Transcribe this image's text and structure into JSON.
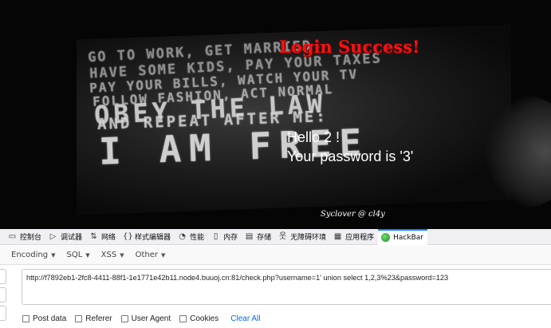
{
  "page": {
    "poster_lines": [
      "GO TO WORK, GET MARRIED",
      "HAVE SOME KIDS, PAY YOUR TAXES",
      "PAY YOUR BILLS, WATCH YOUR TV",
      "FOLLOW FASHION, ACT NORMAL",
      "OBEY THE LAW",
      "AND REPEAT AFTER ME:",
      "I AM FREE"
    ],
    "login_message": "Login Success!",
    "hello": "Hello 2 !",
    "password_message": "Your password is '3'",
    "signature": "Syclover @ cl4y",
    "accent_color": "#ff1010"
  },
  "devtools": {
    "tabs": [
      {
        "icon": "inspector-icon",
        "label": "控制台"
      },
      {
        "icon": "console-icon",
        "label": "调试器"
      },
      {
        "icon": "network-icon",
        "label": "网络"
      },
      {
        "icon": "style-editor-icon",
        "label": "样式编辑器"
      },
      {
        "icon": "performance-icon",
        "label": "性能"
      },
      {
        "icon": "memory-icon",
        "label": "内存"
      },
      {
        "icon": "storage-icon",
        "label": "存储"
      },
      {
        "icon": "accessibility-icon",
        "label": "无障碍环境"
      },
      {
        "icon": "application-icon",
        "label": "应用程序"
      },
      {
        "icon": "hackbar-icon",
        "label": "HackBar"
      }
    ],
    "active_tab": "HackBar",
    "active_color": "#0a84ff"
  },
  "hackbar": {
    "menus": [
      "Encoding",
      "SQL",
      "XSS",
      "Other"
    ],
    "url": "http://f7892eb1-2fc8-4411-88f1-1e1771e42b11.node4.buuoj.cn:81/check.php?username=1' union select 1,2,3%23&password=123",
    "options": [
      "Post data",
      "Referer",
      "User Agent",
      "Cookies"
    ],
    "clear_all": "Clear All"
  }
}
